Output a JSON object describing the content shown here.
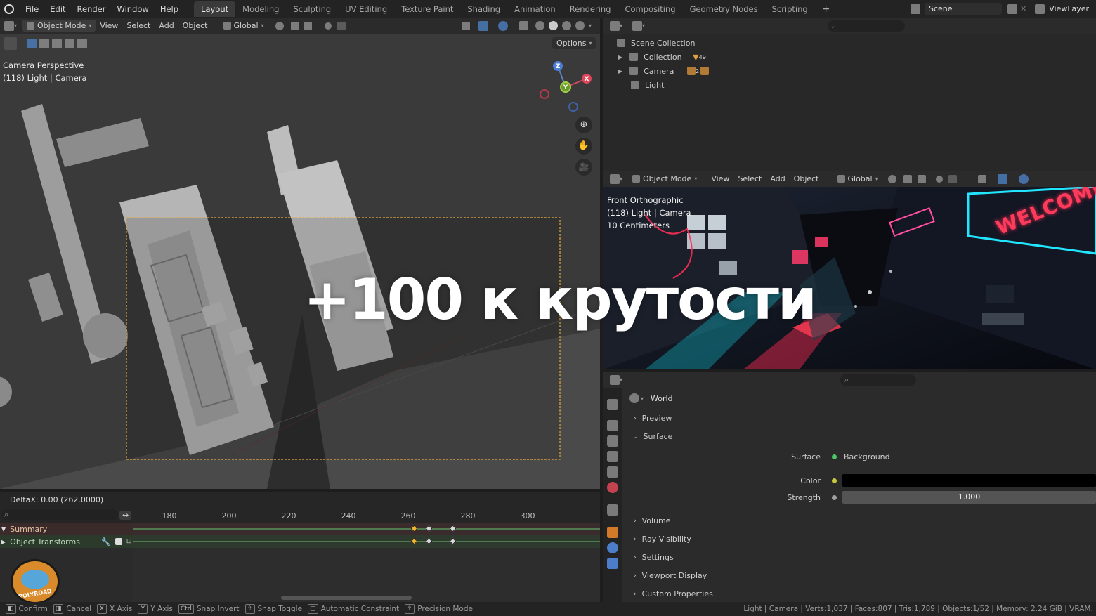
{
  "menu": [
    "File",
    "Edit",
    "Render",
    "Window",
    "Help"
  ],
  "workspaces": [
    "Layout",
    "Modeling",
    "Sculpting",
    "UV Editing",
    "Texture Paint",
    "Shading",
    "Animation",
    "Rendering",
    "Compositing",
    "Geometry Nodes",
    "Scripting"
  ],
  "active_workspace": "Layout",
  "add_tab": "+",
  "scene": "Scene",
  "view_layer": "ViewLayer",
  "viewport_header": {
    "mode": "Object Mode",
    "menus": [
      "View",
      "Select",
      "Add",
      "Object"
    ],
    "transform": "Global",
    "options": "Options"
  },
  "viewport_overlay": {
    "line1": "Camera Perspective",
    "line2": "(118) Light | Camera"
  },
  "gizmo_axes": {
    "x": "X",
    "y": "Y",
    "z": "Z"
  },
  "overlay_text": "+100 к крутости",
  "outliner": {
    "items": [
      {
        "label": "Scene Collection"
      },
      {
        "label": "Collection",
        "badge": "49"
      },
      {
        "label": "Camera",
        "badge": "2"
      },
      {
        "label": "Light"
      }
    ]
  },
  "viewport2_header": {
    "mode": "Object Mode",
    "menus": [
      "View",
      "Select",
      "Add",
      "Object"
    ],
    "transform": "Global"
  },
  "viewport2_overlay": {
    "line1": "Front Orthographic",
    "line2": "(118) Light | Camera",
    "line3": "10 Centimeters"
  },
  "neon": {
    "welcome": "WELCOME"
  },
  "properties": {
    "world": "World",
    "panels": [
      "Preview",
      "Surface"
    ],
    "surface_label": "Surface",
    "surface_value": "Background",
    "color_label": "Color",
    "color_hex": "#000000",
    "strength_label": "Strength",
    "strength_value": "1.000",
    "more_panels": [
      "Volume",
      "Ray Visibility",
      "Settings",
      "Viewport Display",
      "Custom Properties"
    ]
  },
  "delta": "DeltaX: 0.00 (262.0000)",
  "timeline": {
    "ticks": [
      "180",
      "200",
      "220",
      "240",
      "260",
      "280",
      "300"
    ],
    "tick_frames": [
      180,
      200,
      220,
      240,
      260,
      280,
      300
    ],
    "current_frame": 262,
    "channels": [
      {
        "label": "Summary"
      },
      {
        "label": "Object Transforms"
      }
    ],
    "keyframes": [
      262,
      267,
      275
    ]
  },
  "logo": "POLYROAD",
  "status": {
    "items": [
      {
        "key": "",
        "label": "Confirm"
      },
      {
        "key": "",
        "label": "Cancel"
      },
      {
        "key": "X",
        "label": "X Axis"
      },
      {
        "key": "Y",
        "label": "Y Axis"
      },
      {
        "key": "Ctrl",
        "label": "Snap Invert"
      },
      {
        "key": "",
        "label": "Snap Toggle"
      },
      {
        "key": "",
        "label": "Automatic Constraint"
      },
      {
        "key": "",
        "label": "Precision Mode"
      }
    ],
    "stats": "Light | Camera | Verts:1,037 | Faces:807 | Tris:1,789 | Objects:1/52 | Memory: 2.24 GiB | VRAM:"
  }
}
